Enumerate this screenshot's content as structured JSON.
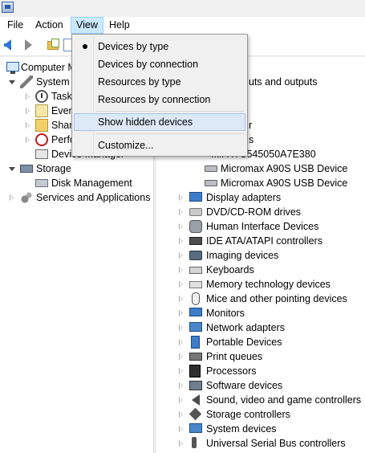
{
  "menubar": {
    "items": [
      {
        "label": "File"
      },
      {
        "label": "Action"
      },
      {
        "label": "View"
      },
      {
        "label": "Help"
      }
    ]
  },
  "view_menu": {
    "items": [
      {
        "label": "Devices by type",
        "checked": true
      },
      {
        "label": "Devices by connection"
      },
      {
        "label": "Resources by type"
      },
      {
        "label": "Resources by connection"
      },
      {
        "label": "Show hidden devices",
        "highlighted": true
      },
      {
        "label": "Customize..."
      }
    ]
  },
  "left_tree": {
    "computer": "Computer M",
    "system_tools": "System T",
    "task": "Task",
    "event": "Even",
    "shared": "Shar",
    "perf": "Perfo",
    "device_manager": "Device Manager",
    "storage": "Storage",
    "disk_management": "Disk Management",
    "services": "Services and Applications"
  },
  "right_tree": {
    "partial_audio": "uts and outputs",
    "partial_r": "r",
    "partial_s": "s",
    "hitachi": "...ii HTS545050A7E380",
    "usb_devices": [
      "Micromax A90S USB Device",
      "Micromax A90S USB Device"
    ],
    "categories": [
      {
        "label": "Display adapters",
        "icon": "display-adapter-icon"
      },
      {
        "label": "DVD/CD-ROM drives",
        "icon": "dvd-drive-icon"
      },
      {
        "label": "Human Interface Devices",
        "icon": "hid-icon"
      },
      {
        "label": "IDE ATA/ATAPI controllers",
        "icon": "ide-controller-icon"
      },
      {
        "label": "Imaging devices",
        "icon": "imaging-device-icon"
      },
      {
        "label": "Keyboards",
        "icon": "keyboard-icon"
      },
      {
        "label": "Memory technology devices",
        "icon": "memory-icon"
      },
      {
        "label": "Mice and other pointing devices",
        "icon": "mouse-icon"
      },
      {
        "label": "Monitors",
        "icon": "monitor-icon"
      },
      {
        "label": "Network adapters",
        "icon": "network-adapter-icon"
      },
      {
        "label": "Portable Devices",
        "icon": "portable-device-icon"
      },
      {
        "label": "Print queues",
        "icon": "printer-icon"
      },
      {
        "label": "Processors",
        "icon": "processor-icon"
      },
      {
        "label": "Software devices",
        "icon": "software-device-icon"
      },
      {
        "label": "Sound, video and game controllers",
        "icon": "speaker-icon"
      },
      {
        "label": "Storage controllers",
        "icon": "storage-controller-icon"
      },
      {
        "label": "System devices",
        "icon": "system-device-icon"
      },
      {
        "label": "Universal Serial Bus controllers",
        "icon": "usb-icon"
      }
    ]
  },
  "colors": {
    "menu_active_bg": "#cce8ff",
    "menu_highlight_bg": "#dde9f7",
    "window_bg": "#f0f0f0"
  }
}
